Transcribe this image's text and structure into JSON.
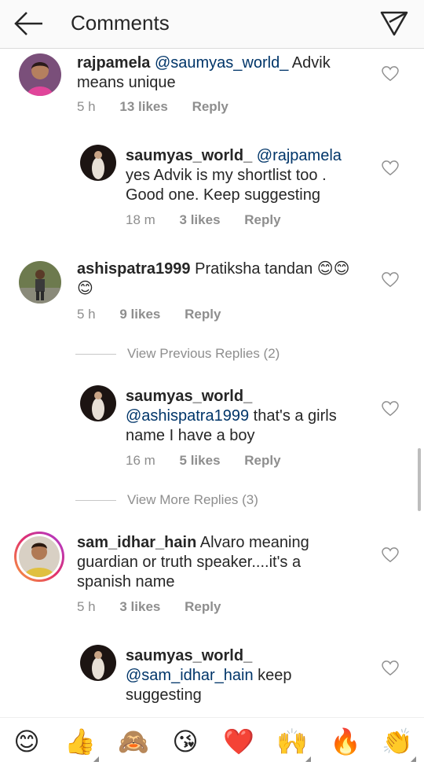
{
  "header": {
    "title": "Comments"
  },
  "comments": [
    {
      "username": "rajpamela",
      "mention": "@saumyas_world_",
      "text_line1": " Advik",
      "text_line2": "means unique",
      "time": "5 h",
      "likes": "13 likes",
      "reply": "Reply"
    },
    {
      "username": "saumyas_world_",
      "mention": "@rajpamela",
      "text_line1": "yes Advik is my shortlist too .",
      "text_line2": "Good one. Keep suggesting",
      "time": "18 m",
      "likes": "3 likes",
      "reply": "Reply"
    },
    {
      "username": "ashispatra1999",
      "text": "Pratiksha tandan",
      "emoji_inline": "😊😊",
      "emoji_line2": "😊",
      "time": "5 h",
      "likes": "9 likes",
      "reply": "Reply"
    },
    {
      "username": "saumyas_world_",
      "mention": "@ashispatra1999",
      "text_line1": " that's a girls",
      "text_line2": "name I have a boy",
      "time": "16 m",
      "likes": "5 likes",
      "reply": "Reply"
    },
    {
      "username": "sam_idhar_hain",
      "text_line1": " Alvaro meaning",
      "text_line2": "guardian or truth speaker....it's a",
      "text_line3": "spanish name",
      "time": "5 h",
      "likes": "3 likes",
      "reply": "Reply"
    },
    {
      "username": "saumyas_world_",
      "mention": "@sam_idhar_hain",
      "text_line2": " keep",
      "text_line3": "suggesting"
    }
  ],
  "view_previous": "View Previous Replies (2)",
  "view_more": "View More Replies (3)",
  "emoji_bar": [
    "😊",
    "👍",
    "🙈",
    "😘",
    "❤️",
    "🙌",
    "🔥",
    "👏"
  ]
}
